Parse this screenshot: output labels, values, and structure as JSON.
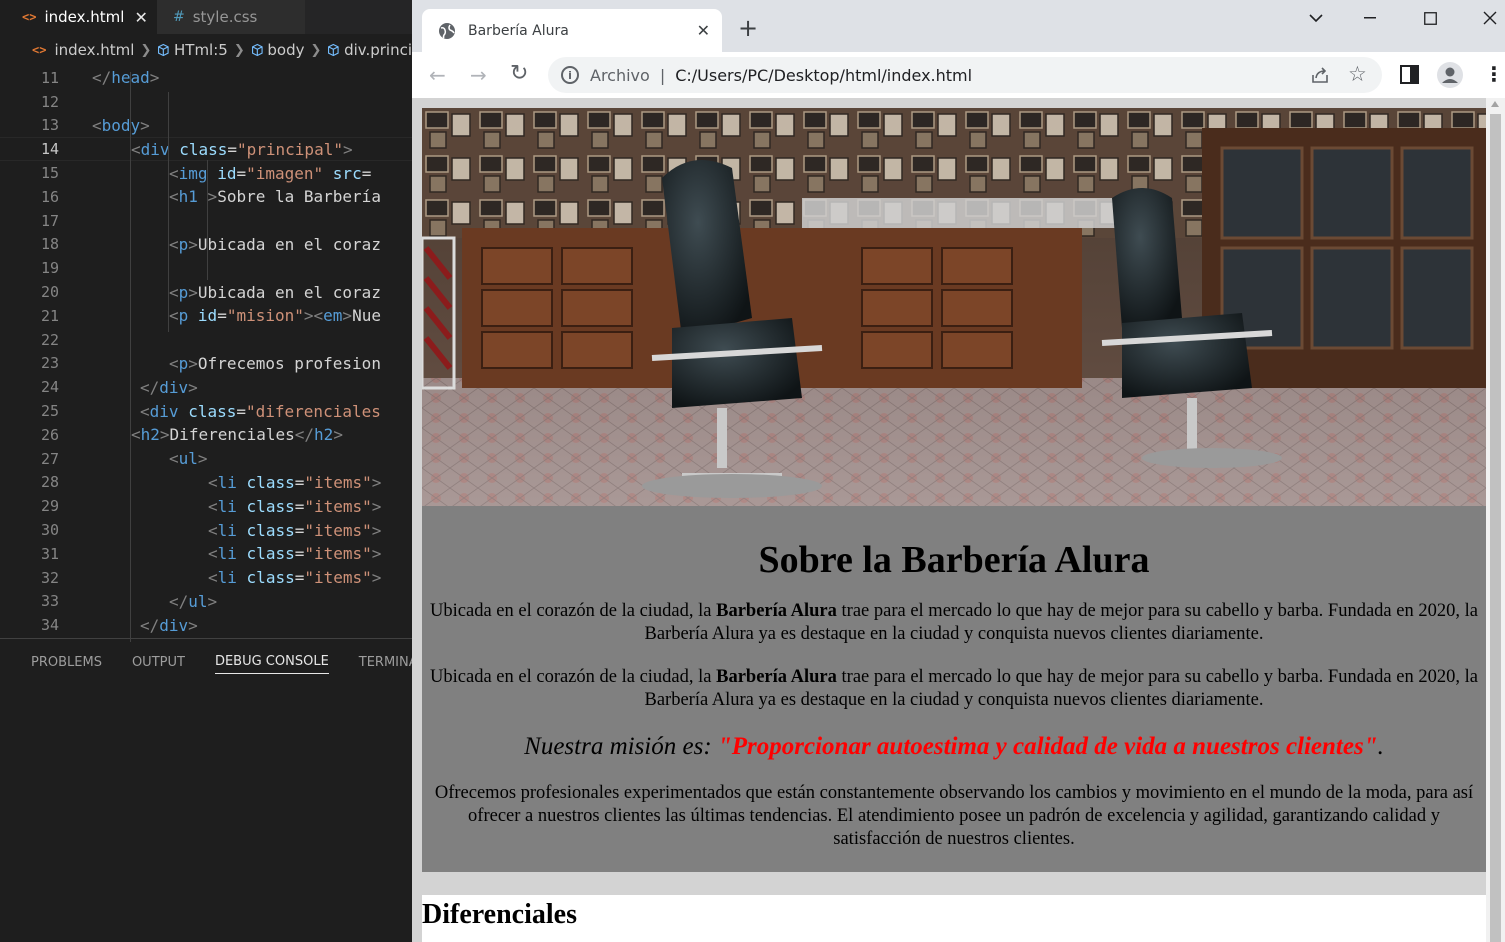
{
  "vscode": {
    "tabs": [
      {
        "icon": "<>",
        "label": "index.html",
        "close": "✕"
      },
      {
        "icon": "#",
        "label": "style.css"
      }
    ],
    "breadcrumb": [
      "index.html",
      "HTml:5",
      "body",
      "div.princi"
    ],
    "lines": [
      {
        "n": "11",
        "indent": 1,
        "html": "<span class='t'>&lt;/</span><span class='tg'>head</span><span class='t'>&gt;</span>"
      },
      {
        "n": "12",
        "indent": 0,
        "html": ""
      },
      {
        "n": "13",
        "indent": 1,
        "html": "<span class='t'>&lt;</span><span class='tg'>body</span><span class='t'>&gt;</span>"
      },
      {
        "n": "14",
        "indent": 2,
        "html": "<span class='t'>&lt;</span><span class='tg'>div</span> <span class='at'>class</span><span class='tx'>=</span><span class='st'>\"principal\"</span><span class='t'>&gt;</span>"
      },
      {
        "n": "15",
        "indent": 3,
        "html": "<span class='t'>&lt;</span><span class='tg'>img</span> <span class='at'>id</span><span class='tx'>=</span><span class='st'>\"imagen\"</span> <span class='at'>src</span><span class='tx'>=</span>"
      },
      {
        "n": "16",
        "indent": 3,
        "html": "<span class='t'>&lt;</span><span class='tg'>h1</span> <span class='t'>&gt;</span><span class='tx'>Sobre la Barbería</span>"
      },
      {
        "n": "17",
        "indent": 0,
        "html": ""
      },
      {
        "n": "18",
        "indent": 3,
        "html": "<span class='t'>&lt;</span><span class='tg'>p</span><span class='t'>&gt;</span><span class='tx'>Ubicada en el coraz</span>"
      },
      {
        "n": "19",
        "indent": 0,
        "html": ""
      },
      {
        "n": "20",
        "indent": 3,
        "html": "<span class='t'>&lt;</span><span class='tg'>p</span><span class='t'>&gt;</span><span class='tx'>Ubicada en el coraz</span>"
      },
      {
        "n": "21",
        "indent": 3,
        "html": "<span class='t'>&lt;</span><span class='tg'>p</span> <span class='at'>id</span><span class='tx'>=</span><span class='st'>\"mision\"</span><span class='t'>&gt;&lt;</span><span class='tg'>em</span><span class='t'>&gt;</span><span class='tx'>Nue</span>"
      },
      {
        "n": "22",
        "indent": 0,
        "html": ""
      },
      {
        "n": "23",
        "indent": 3,
        "html": "<span class='t'>&lt;</span><span class='tg'>p</span><span class='t'>&gt;</span><span class='tx'>Ofrecemos profesion</span>"
      },
      {
        "n": "24",
        "indent": 2.25,
        "html": "<span class='t'>&lt;/</span><span class='tg'>div</span><span class='t'>&gt;</span>"
      },
      {
        "n": "25",
        "indent": 2.25,
        "html": "<span class='t'>&lt;</span><span class='tg'>div</span> <span class='at'>class</span><span class='tx'>=</span><span class='st'>\"diferenciales</span>"
      },
      {
        "n": "26",
        "indent": 2,
        "html": "<span class='t'>&lt;</span><span class='tg'>h2</span><span class='t'>&gt;</span><span class='tx'>Diferenciales</span><span class='t'>&lt;/</span><span class='tg'>h2</span><span class='t'>&gt;</span>"
      },
      {
        "n": "27",
        "indent": 3,
        "html": "<span class='t'>&lt;</span><span class='tg'>ul</span><span class='t'>&gt;</span>"
      },
      {
        "n": "28",
        "indent": 4,
        "html": "<span class='t'>&lt;</span><span class='tg'>li</span> <span class='at'>class</span><span class='tx'>=</span><span class='st'>\"items\"</span><span class='t'>&gt;</span>"
      },
      {
        "n": "29",
        "indent": 4,
        "html": "<span class='t'>&lt;</span><span class='tg'>li</span> <span class='at'>class</span><span class='tx'>=</span><span class='st'>\"items\"</span><span class='t'>&gt;</span>"
      },
      {
        "n": "30",
        "indent": 4,
        "html": "<span class='t'>&lt;</span><span class='tg'>li</span> <span class='at'>class</span><span class='tx'>=</span><span class='st'>\"items\"</span><span class='t'>&gt;</span>"
      },
      {
        "n": "31",
        "indent": 4,
        "html": "<span class='t'>&lt;</span><span class='tg'>li</span> <span class='at'>class</span><span class='tx'>=</span><span class='st'>\"items\"</span><span class='t'>&gt;</span>"
      },
      {
        "n": "32",
        "indent": 4,
        "html": "<span class='t'>&lt;</span><span class='tg'>li</span> <span class='at'>class</span><span class='tx'>=</span><span class='st'>\"items\"</span><span class='t'>&gt;</span>"
      },
      {
        "n": "33",
        "indent": 3,
        "html": "<span class='t'>&lt;/</span><span class='tg'>ul</span><span class='t'>&gt;</span>"
      },
      {
        "n": "34",
        "indent": 2.25,
        "html": "<span class='t'>&lt;/</span><span class='tg'>div</span><span class='t'>&gt;</span>"
      }
    ],
    "current_line": "14",
    "panel_tabs": [
      {
        "label": "PROBLEMS",
        "active": false
      },
      {
        "label": "OUTPUT",
        "active": false
      },
      {
        "label": "DEBUG CONSOLE",
        "active": true
      },
      {
        "label": "TERMINAL",
        "active": false
      }
    ]
  },
  "chrome": {
    "tab_title": "Barbería Alura",
    "tab_close": "✕",
    "new_tab": "+",
    "window_controls": {
      "dropdown": "⌄",
      "minimize": "—",
      "maximize": "☐",
      "close": "✕"
    },
    "back": "←",
    "forward": "→",
    "reload": "↻",
    "site_label": "Archivo",
    "separator": "|",
    "url": "C:/Users/PC/Desktop/html/index.html",
    "share_icon": "⇪",
    "star_icon": "☆",
    "menu_icon": "⋮"
  },
  "page": {
    "title": "Sobre la Barbería Alura",
    "p1_before": "Ubicada en el corazón de la ciudad, la ",
    "p1_bold": "Barbería Alura",
    "p1_after": " trae para el mercado lo que hay de mejor para su cabello y barba. Fundada en 2020, la Barbería Alura ya es destaque en la ciudad y conquista nuevos clientes diariamente.",
    "p2_before": "Ubicada en el corazón de la ciudad, la ",
    "p2_bold": "Barbería Alura",
    "p2_after": " trae para el mercado lo que hay de mejor para su cabello y barba. Fundada en 2020, la Barbería Alura ya es destaque en la ciudad y conquista nuevos clientes diariamente.",
    "mision_em": "Nuestra misión es: ",
    "mision_strong": "\"Proporcionar autoestima y calidad de vida a nuestros clientes\"",
    "mision_end": ".",
    "p4": "Ofrecemos profesionales experimentados que están constantemente observando los cambios y movimiento en el mundo de la moda, para así ofrecer a nuestros clientes las últimas tendencias. El atendimiento posee un padrón de excelencia y agilidad, garantizando calidad y satisfacción de nuestros clientes.",
    "h2": "Diferenciales"
  }
}
